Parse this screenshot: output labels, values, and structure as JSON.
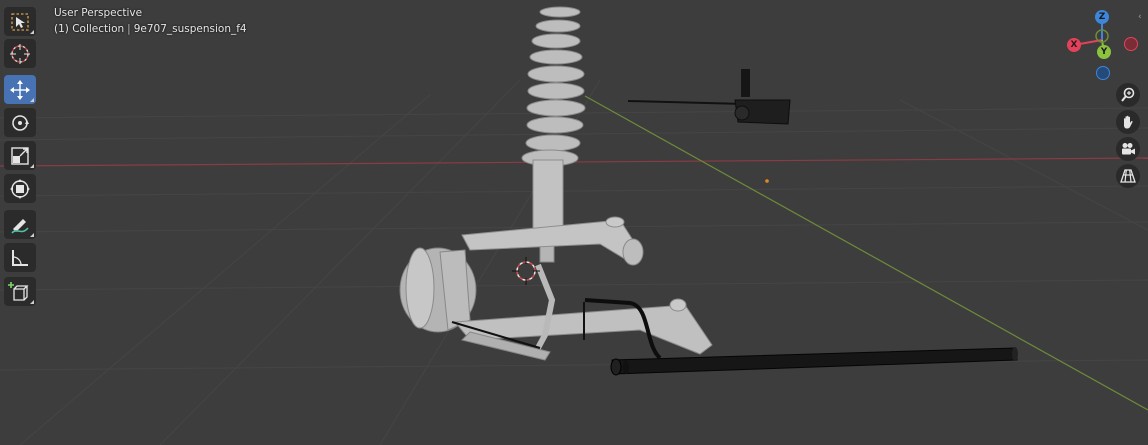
{
  "viewport": {
    "title": "User Perspective",
    "collection": "(1) Collection",
    "object_name": "9e707_suspension_f4",
    "background": "#3d3d3d"
  },
  "toolbar": {
    "tools": [
      {
        "name": "select-box-tool",
        "icon": "select-box-icon",
        "active": false
      },
      {
        "name": "cursor-tool",
        "icon": "cursor-icon",
        "active": false
      },
      {
        "name": "move-tool",
        "icon": "move-icon",
        "active": true
      },
      {
        "name": "rotate-tool",
        "icon": "rotate-icon",
        "active": false
      },
      {
        "name": "scale-tool",
        "icon": "scale-icon",
        "active": false
      },
      {
        "name": "transform-tool",
        "icon": "transform-icon",
        "active": false
      },
      {
        "name": "annotate-tool",
        "icon": "annotate-icon",
        "active": false
      },
      {
        "name": "measure-tool",
        "icon": "measure-icon",
        "active": false
      },
      {
        "name": "add-cube-tool",
        "icon": "add-cube-icon",
        "active": false
      }
    ],
    "active_color": "#4772b3"
  },
  "gizmo": {
    "x_label": "X",
    "y_label": "Y",
    "z_label": "Z",
    "x_color": "#e4425a",
    "y_color": "#8bc23e",
    "z_color": "#3d86db"
  },
  "navigation": [
    "zoom-icon",
    "hand-pan-icon",
    "camera-icon",
    "grid-view-icon"
  ]
}
